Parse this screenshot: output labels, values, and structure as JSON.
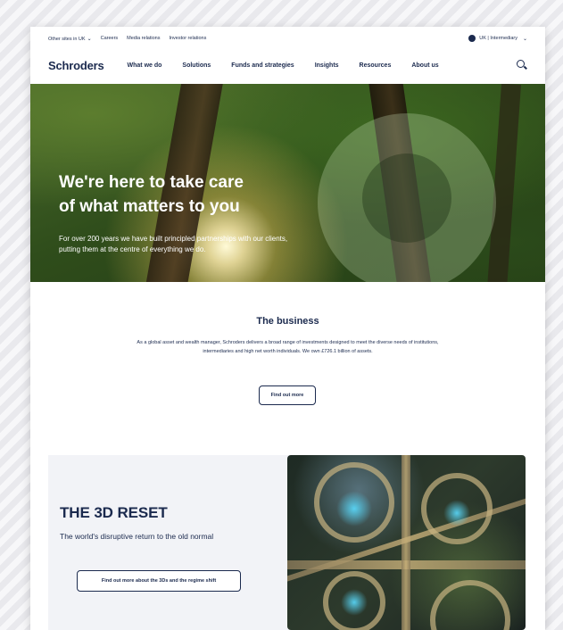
{
  "utility": {
    "other_sites": "Other sites in UK",
    "careers": "Careers",
    "media": "Media relations",
    "investor": "Investor relations",
    "region": "UK | Intermediary"
  },
  "nav": {
    "logo": "Schroders",
    "items": [
      {
        "label": "What we do"
      },
      {
        "label": "Solutions"
      },
      {
        "label": "Funds and strategies"
      },
      {
        "label": "Insights"
      },
      {
        "label": "Resources"
      },
      {
        "label": "About us"
      }
    ]
  },
  "hero": {
    "title_line1": "We're here to take care",
    "title_line2": "of what matters to you",
    "subtitle": "For over 200 years we have built principled partnerships with our clients, putting them at the centre of everything we do."
  },
  "business": {
    "title": "The business",
    "text": "As a global asset and wealth manager, Schroders delivers a broad range of investments designed to meet the diverse needs of institutions, intermediaries and high net worth individuals. We own £726.1 billion of assets.",
    "button": "Find out more"
  },
  "reset": {
    "title": "THE 3D RESET",
    "subtitle": "The world's disruptive return to the old normal",
    "button": "Find out more about the 3Ds and the regime shift"
  }
}
